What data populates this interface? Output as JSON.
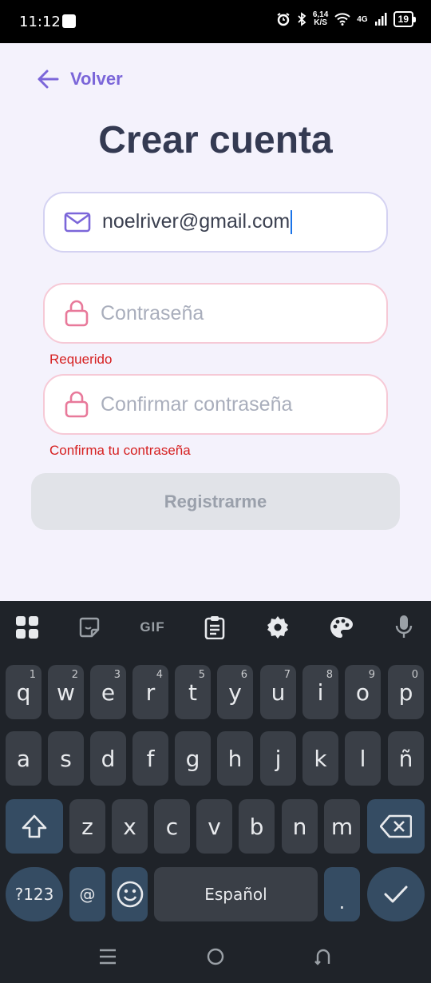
{
  "status_bar": {
    "time": "11:12",
    "speed_top": "6,14",
    "speed_bottom": "K/S",
    "network": "4G",
    "battery": "19"
  },
  "header": {
    "back_label": "Volver",
    "title": "Crear cuenta"
  },
  "form": {
    "email_value": "noelriver@gmail.com",
    "password_placeholder": "Contraseña",
    "password_error": "Requerido",
    "confirm_placeholder": "Confirmar contraseña",
    "confirm_error": "Confirma tu contraseña",
    "submit_label": "Registrarme"
  },
  "colors": {
    "accent": "#7b66d9",
    "error": "#d62020",
    "error_icon": "#e8799a",
    "title": "#343a52"
  },
  "keyboard": {
    "toolbar_icons": [
      "apps-grid-icon",
      "sticker-icon",
      "gif-icon",
      "clipboard-icon",
      "settings-icon",
      "palette-icon",
      "microphone-icon"
    ],
    "gif_label": "GIF",
    "row1": [
      {
        "key": "q",
        "num": "1"
      },
      {
        "key": "w",
        "num": "2"
      },
      {
        "key": "e",
        "num": "3"
      },
      {
        "key": "r",
        "num": "4"
      },
      {
        "key": "t",
        "num": "5"
      },
      {
        "key": "y",
        "num": "6"
      },
      {
        "key": "u",
        "num": "7"
      },
      {
        "key": "i",
        "num": "8"
      },
      {
        "key": "o",
        "num": "9"
      },
      {
        "key": "p",
        "num": "0"
      }
    ],
    "row2": [
      "a",
      "s",
      "d",
      "f",
      "g",
      "h",
      "j",
      "k",
      "l",
      "ñ"
    ],
    "row3": [
      "z",
      "x",
      "c",
      "v",
      "b",
      "n",
      "m"
    ],
    "symbols_label": "?123",
    "at_label": "@",
    "space_label": "Español",
    "period_label": "."
  }
}
